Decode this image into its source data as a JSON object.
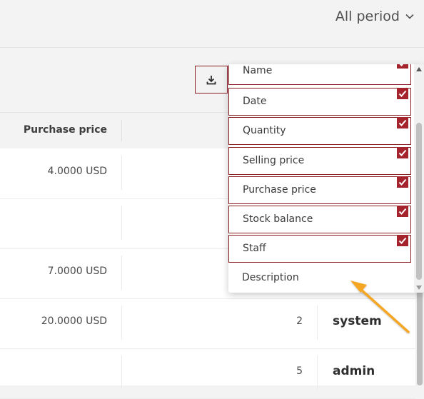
{
  "header": {
    "period_label": "All period",
    "period_icon": "chevron-down-icon"
  },
  "toolbar": {
    "download_icon": "download-icon"
  },
  "table": {
    "columns": {
      "purchase_price": "Purchase price"
    },
    "rows": [
      {
        "purchase_price": "4.0000 USD",
        "quantity": "",
        "staff": ""
      },
      {
        "purchase_price": "",
        "quantity": "",
        "staff": ""
      },
      {
        "purchase_price": "7.0000 USD",
        "quantity": "",
        "staff": ""
      },
      {
        "purchase_price": "20.0000 USD",
        "quantity": "2",
        "staff": "system"
      },
      {
        "purchase_price": "",
        "quantity": "5",
        "staff": "admin"
      }
    ]
  },
  "column_menu": {
    "options": [
      {
        "label": "Name",
        "checked": true
      },
      {
        "label": "Date",
        "checked": true
      },
      {
        "label": "Quantity",
        "checked": true
      },
      {
        "label": "Selling price",
        "checked": true
      },
      {
        "label": "Purchase price",
        "checked": true
      },
      {
        "label": "Stock balance",
        "checked": true
      },
      {
        "label": "Staff",
        "checked": true
      },
      {
        "label": "Description",
        "checked": false
      }
    ]
  },
  "colors": {
    "accent": "#a4232c",
    "border_accent": "#8b1d24",
    "arrow": "#f5a623"
  }
}
